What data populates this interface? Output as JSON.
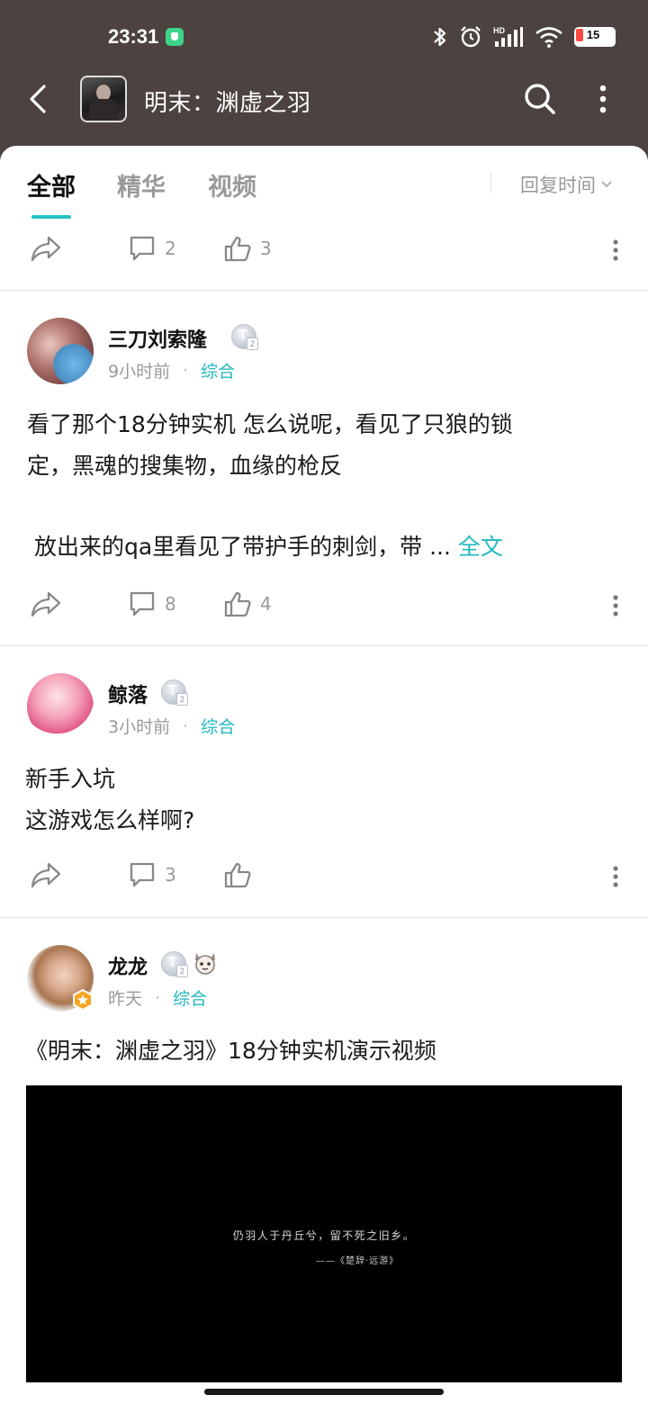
{
  "status_bar": {
    "time": "23:31",
    "battery": "15",
    "icons": [
      "bluetooth-icon",
      "alarm-icon",
      "hd-signal-icon",
      "wifi-icon",
      "battery-icon"
    ]
  },
  "header": {
    "title": "明末：渊虚之羽",
    "back_icon": "back-arrow-icon",
    "search_icon": "search-icon",
    "more_icon": "more-vertical-icon"
  },
  "tabs": {
    "items": [
      "全部",
      "精华",
      "视频"
    ],
    "active": "全部",
    "sort_label": "回复时间"
  },
  "colors": {
    "accent": "#23c3c7",
    "header_bg": "#4c4340",
    "muted": "#999999"
  },
  "top_actions": {
    "comments": "2",
    "likes": "3"
  },
  "posts": [
    {
      "username": "三刀刘索隆",
      "time": "9小时前",
      "category": "综合",
      "text_line1": "看了那个18分钟实机 怎么说呢，看见了只狼的锁",
      "text_line2": "定，黑魂的搜集物，血缘的枪反",
      "text_line3": " 放出来的qa里看见了带护手的刺剑，带 ...",
      "more": "全文",
      "comments": "8",
      "likes": "4"
    },
    {
      "username": "鲸落",
      "time": "3小时前",
      "category": "综合",
      "text_line1": "新手入坑",
      "text_line2": "这游戏怎么样啊?",
      "comments": "3",
      "likes": ""
    },
    {
      "username": "龙龙",
      "time": "昨天",
      "category": "综合",
      "text_line1": "《明末：渊虚之羽》18分钟实机演示视频",
      "video_quote": "仍羽人于丹丘兮，留不死之旧乡。",
      "video_source": "——《楚辞·远游》"
    }
  ]
}
